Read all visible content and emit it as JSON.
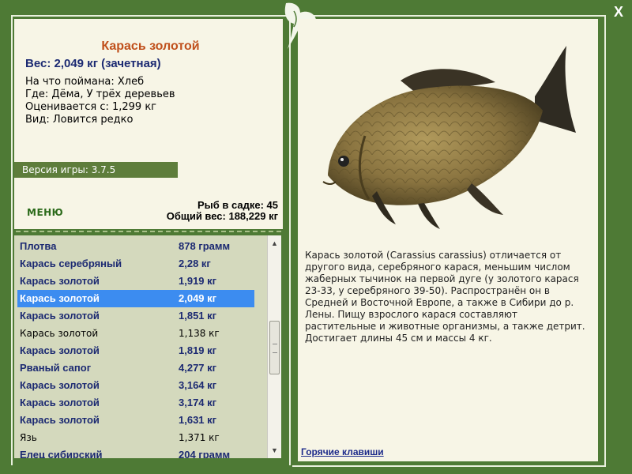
{
  "info": {
    "title": "Карась золотой",
    "weight": "Вес: 2,049 кг (зачетная)",
    "bait": "На что поймана: Хлеб",
    "location": "Где: Дёма, У трёх деревьев",
    "value": "Оценивается с: 1,299 кг",
    "species": "Вид: Ловится редко",
    "version": "Версия игры: 3.7.5",
    "menu_label": "МЕНЮ",
    "keep_count": "Рыб в садке: 45",
    "total_weight": "Общий вес: 188,229 кг"
  },
  "catch_list": [
    {
      "name": "Плотва",
      "weight": "878 грамм",
      "style": "bold"
    },
    {
      "name": "Карась серебряный",
      "weight": "2,28 кг",
      "style": "bold"
    },
    {
      "name": "Карась золотой",
      "weight": "1,919 кг",
      "style": "bold"
    },
    {
      "name": "Карась золотой",
      "weight": "2,049 кг",
      "style": "selected"
    },
    {
      "name": "Карась золотой",
      "weight": "1,851 кг",
      "style": "bold"
    },
    {
      "name": "Карась золотой",
      "weight": "1,138 кг",
      "style": "normal"
    },
    {
      "name": "Карась золотой",
      "weight": "1,819 кг",
      "style": "bold"
    },
    {
      "name": "Рваный сапог",
      "weight": "4,277 кг",
      "style": "bold"
    },
    {
      "name": "Карась золотой",
      "weight": "3,164 кг",
      "style": "bold"
    },
    {
      "name": "Карась золотой",
      "weight": "3,174 кг",
      "style": "bold"
    },
    {
      "name": "Карась золотой",
      "weight": "1,631 кг",
      "style": "bold"
    },
    {
      "name": "Язь",
      "weight": "1,371 кг",
      "style": "normal"
    },
    {
      "name": "Елец сибирский",
      "weight": "204 грамм",
      "style": "bold"
    }
  ],
  "scrollbar": {
    "up": "▲",
    "down": "▼"
  },
  "detail": {
    "description": "Карась золотой (Carassius carassius) отличается от другого вида, серебряного карася, меньшим числом жаберных тычинок на первой дуге (у золотого карася 23-33, у серебряного 39-50). Распространён он в Средней и Восточной Европе, а также в Сибири до р. Лены. Пищу взрослого карася составляют растительные и животные организмы, а также детрит. Достигает длины 45 см и массы 4 кг.",
    "hotkeys": "Горячие клавиши"
  },
  "window": {
    "close": "X"
  },
  "icons": {
    "close": "close-icon",
    "ornament": "leaf-ornament-icon",
    "fish": "crucian-carp-image"
  }
}
